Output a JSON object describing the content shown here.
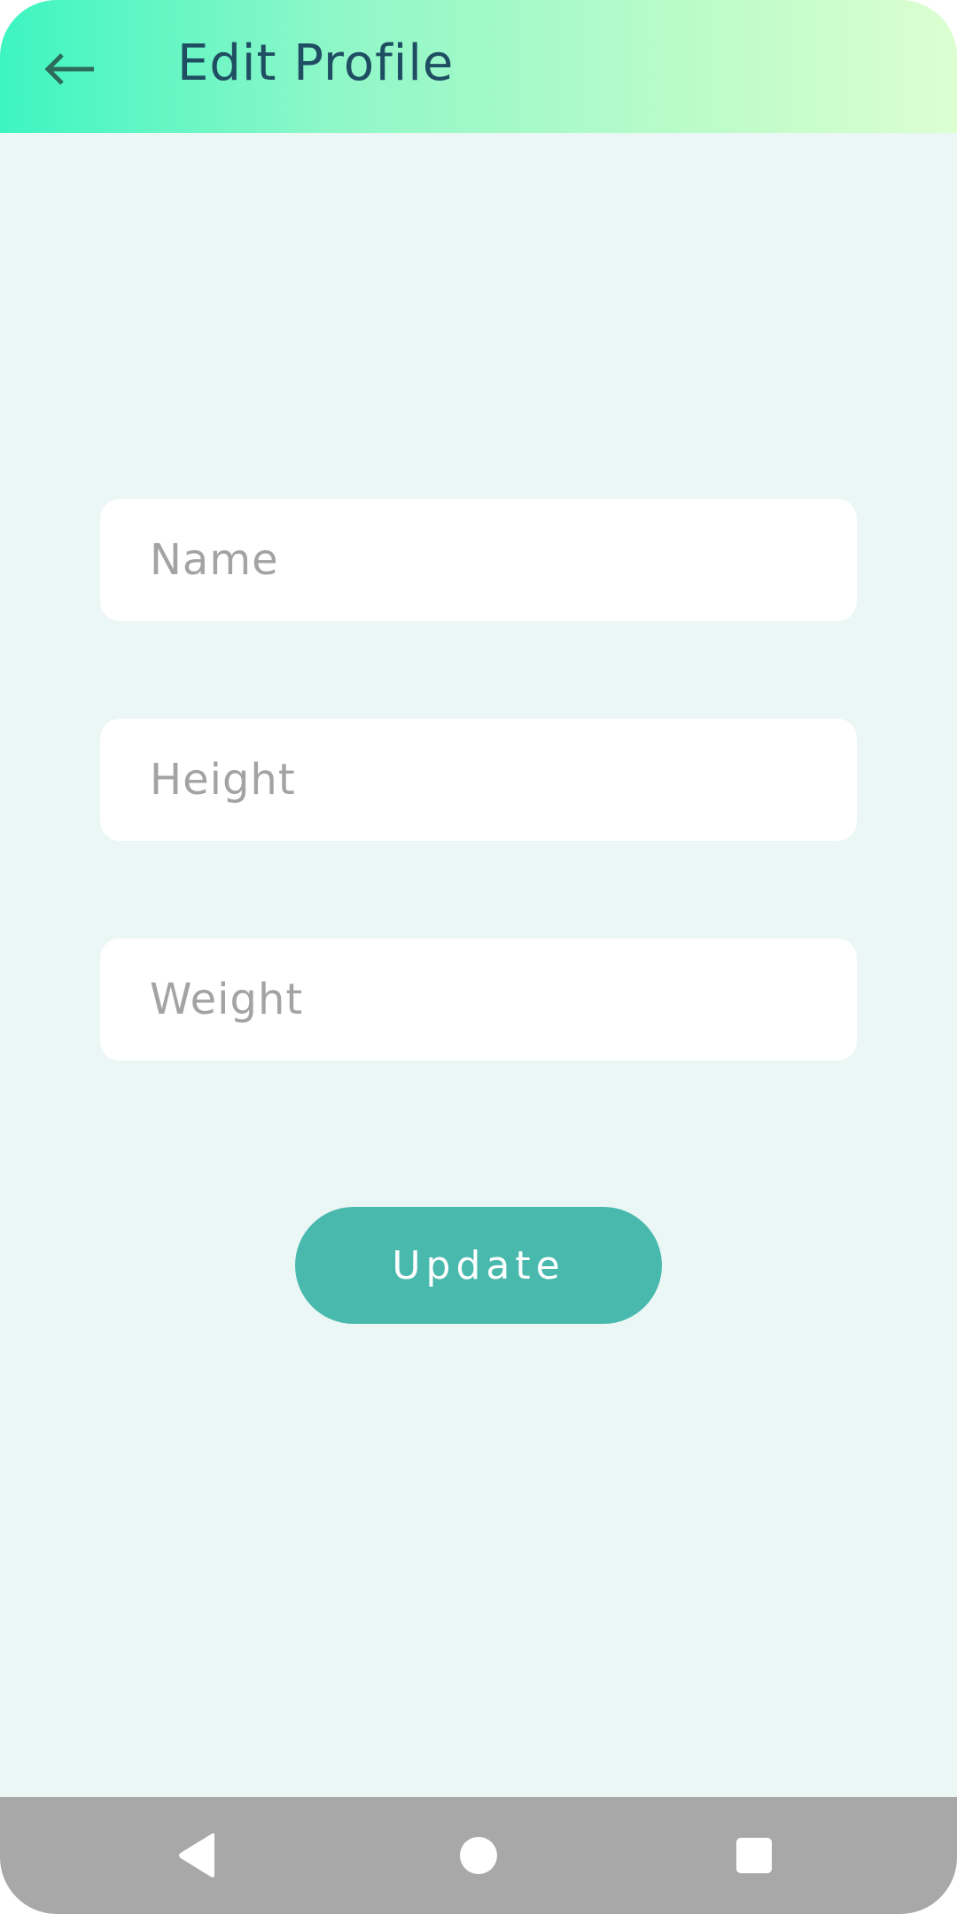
{
  "header": {
    "title": "Edit Profile",
    "back_icon": "arrow-left-icon",
    "gradient_start": "#3df5c1",
    "gradient_end": "#dcffd0",
    "title_color": "#1f4e63"
  },
  "form": {
    "name": {
      "placeholder": "Name",
      "value": ""
    },
    "height": {
      "placeholder": "Height",
      "value": ""
    },
    "weight": {
      "placeholder": "Weight",
      "value": ""
    },
    "update_label": "Update",
    "button_color": "#49b9ae"
  },
  "navigation": {
    "back_icon": "nav-back-triangle-icon",
    "home_icon": "nav-home-circle-icon",
    "recent_icon": "nav-recent-square-icon",
    "bar_color": "#a8a8a8"
  },
  "colors": {
    "background": "#eaf7f5",
    "placeholder": "#a3a3a3"
  }
}
